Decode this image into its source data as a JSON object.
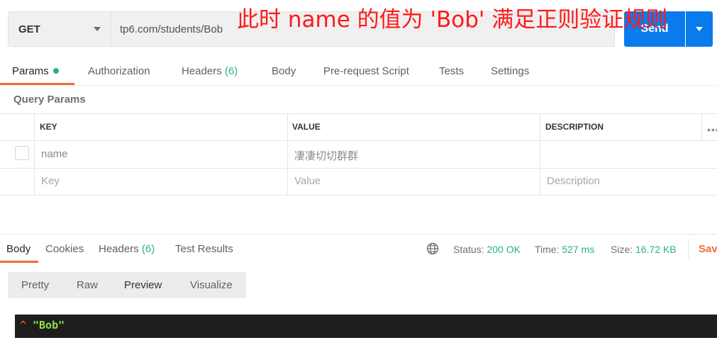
{
  "request": {
    "method": "GET",
    "url": "tp6.com/students/Bob",
    "send_label": "Send"
  },
  "annotation": "此时 name 的值为 'Bob' 满足正则验证规则",
  "request_tabs": [
    {
      "label": "Params"
    },
    {
      "label": "Authorization"
    },
    {
      "label": "Headers",
      "count": "(6)"
    },
    {
      "label": "Body"
    },
    {
      "label": "Pre-request Script"
    },
    {
      "label": "Tests"
    },
    {
      "label": "Settings"
    }
  ],
  "query_params": {
    "title": "Query Params",
    "columns": [
      "KEY",
      "VALUE",
      "DESCRIPTION"
    ],
    "more": "•••",
    "rows": [
      {
        "key": "name",
        "value": "凄凄切切群群",
        "description": ""
      }
    ],
    "placeholder": {
      "key": "Key",
      "value": "Value",
      "description": "Description"
    }
  },
  "response": {
    "tabs": [
      {
        "label": "Body"
      },
      {
        "label": "Cookies"
      },
      {
        "label": "Headers",
        "count": "(6)"
      },
      {
        "label": "Test Results"
      }
    ],
    "status_label": "Status:",
    "status_value": "200 OK",
    "time_label": "Time:",
    "time_value": "527 ms",
    "size_label": "Size:",
    "size_value": "16.72 KB",
    "save_label": "Save",
    "view_modes": [
      "Pretty",
      "Raw",
      "Preview",
      "Visualize"
    ],
    "body_caret": "^",
    "body_value": "\"Bob\""
  },
  "colors": {
    "accent": "#f26b3a",
    "send": "#097bed",
    "success": "#26b47f",
    "annotation": "#ff1a1a"
  }
}
